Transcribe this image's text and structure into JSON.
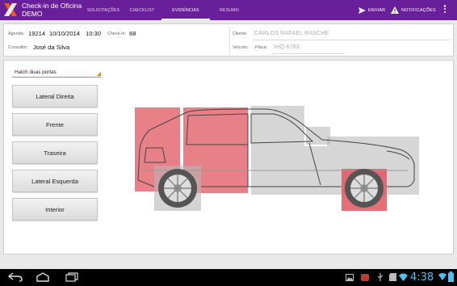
{
  "app": {
    "title_line1": "Check-in de Oficina",
    "title_line2": "DEMO",
    "logo_icon": "x-logo-icon",
    "brand_color": "#6a1f9a"
  },
  "tabs": [
    {
      "label": "SOLICITAÇÕES",
      "active": false
    },
    {
      "label": "CHECKLIST",
      "active": false
    },
    {
      "label": "EVIDÊNCIAS",
      "active": true
    },
    {
      "label": "RESUMO",
      "active": false
    }
  ],
  "actions": {
    "send": {
      "label": "ENVIAR",
      "icon": "send-icon"
    },
    "notifications": {
      "label": "NOTIFICAÇÕES",
      "icon": "warning-icon"
    },
    "overflow_icon": "overflow-menu-icon"
  },
  "info": {
    "agenda_label": "Agenda:",
    "agenda_number": "19214",
    "agenda_date": "10/10/2014",
    "agenda_time": "10:30",
    "checkin_label": "Check-In:",
    "checkin_value": "68",
    "consultor_label": "Consultor:",
    "consultor_value": "José da Silva",
    "cliente_label": "Cliente:",
    "cliente_value": "CARLOS RAFAEL RASCHE",
    "veiculo_label": "Veículo:",
    "placa_label": "Placa:",
    "placa_value": "IHQ-6783"
  },
  "main": {
    "vehicle_type": "Hatch duas portas",
    "view_buttons": [
      "Lateral Direita",
      "Frente",
      "Traseira",
      "Lateral Esquerda",
      "Interior"
    ],
    "highlight_color": "#e0555f",
    "grid_color": "#b5b5b5"
  },
  "system": {
    "clock": "4:38",
    "nav_icons": [
      "back-icon",
      "home-icon",
      "recent-apps-icon"
    ],
    "status_icons": [
      "gallery-icon",
      "app-icon",
      "usb-icon",
      "sd-card-icon",
      "wifi-icon",
      "battery-icon"
    ],
    "clock_color": "#4dc2f0"
  }
}
